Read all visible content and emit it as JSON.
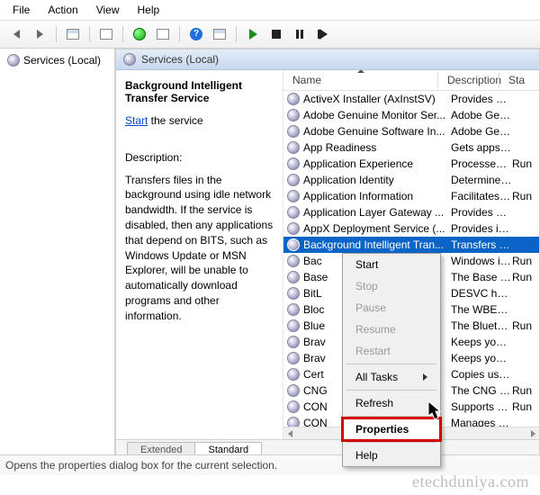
{
  "menu": {
    "file": "File",
    "action": "Action",
    "view": "View",
    "help": "Help"
  },
  "tree": {
    "root": "Services (Local)"
  },
  "inner_title": "Services (Local)",
  "detail": {
    "heading": "Background Intelligent Transfer Service",
    "start_link": "Start",
    "start_suffix": " the service",
    "desc_label": "Description:",
    "desc_text": "Transfers files in the background using idle network bandwidth. If the service is disabled, then any applications that depend on BITS, such as Windows Update or MSN Explorer, will be unable to automatically download programs and other information."
  },
  "columns": {
    "name": "Name",
    "description": "Description",
    "status": "Sta"
  },
  "services": [
    {
      "name": "ActiveX Installer (AxInstSV)",
      "desc": "Provides Us...",
      "status": ""
    },
    {
      "name": "Adobe Genuine Monitor Ser...",
      "desc": "Adobe Gen...",
      "status": ""
    },
    {
      "name": "Adobe Genuine Software In...",
      "desc": "Adobe Gen...",
      "status": ""
    },
    {
      "name": "App Readiness",
      "desc": "Gets apps re...",
      "status": ""
    },
    {
      "name": "Application Experience",
      "desc": "Processes a...",
      "status": "Run"
    },
    {
      "name": "Application Identity",
      "desc": "Determines ...",
      "status": ""
    },
    {
      "name": "Application Information",
      "desc": "Facilitates t...",
      "status": "Run"
    },
    {
      "name": "Application Layer Gateway ...",
      "desc": "Provides su...",
      "status": ""
    },
    {
      "name": "AppX Deployment Service (...",
      "desc": "Provides inf...",
      "status": ""
    },
    {
      "name": "Background Intelligent Tran...",
      "desc": "Transfers fil...",
      "status": "",
      "selected": true
    },
    {
      "name": "Bac",
      "desc": "Windows in...",
      "status": "Run"
    },
    {
      "name": "Base",
      "desc": "The Base Fil...",
      "status": "Run"
    },
    {
      "name": "BitL",
      "desc": "DESVC hos...",
      "status": ""
    },
    {
      "name": "Bloc",
      "desc": "The WBENG...",
      "status": ""
    },
    {
      "name": "Blue",
      "desc": "The Bluetoo...",
      "status": "Run"
    },
    {
      "name": "Brav",
      "desc": "Keeps your ...",
      "status": ""
    },
    {
      "name": "Brav",
      "desc": "Keeps your ...",
      "status": ""
    },
    {
      "name": "Cert",
      "desc": "Copies user ...",
      "status": ""
    },
    {
      "name": "CNG",
      "desc": "The CNG ke...",
      "status": "Run"
    },
    {
      "name": "CON",
      "desc": "Supports Sy...",
      "status": "Run"
    },
    {
      "name": "CON",
      "desc": "Manages th...",
      "status": ""
    }
  ],
  "context_menu": {
    "start": "Start",
    "stop": "Stop",
    "pause": "Pause",
    "resume": "Resume",
    "restart": "Restart",
    "all_tasks": "All Tasks",
    "refresh": "Refresh",
    "properties": "Properties",
    "help": "Help"
  },
  "tabs": {
    "extended": "Extended",
    "standard": "Standard"
  },
  "statusbar": "Opens the properties dialog box for the current selection.",
  "watermark": "etechduniya.com"
}
